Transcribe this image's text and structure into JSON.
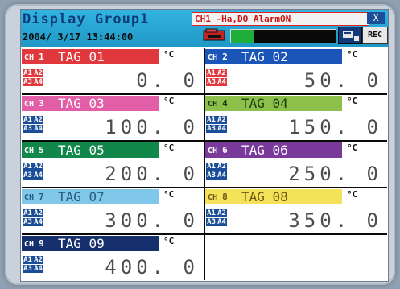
{
  "header": {
    "title": "Display Group1",
    "datetime": "2004/ 3/17 13:44:00",
    "alarm_text": "CH1 -Ha,DO AlarmON",
    "alarm_close": "X",
    "rec_label": "REC",
    "memory_fill_fraction": 0.22,
    "colors": {
      "header_bg": "#2aa9d6",
      "alarm_text": "#d01010",
      "memory_bar": "#1fae3a"
    }
  },
  "channels": [
    {
      "ch": "1",
      "tag": "TAG 01",
      "unit": "°C",
      "value": "0. 0",
      "color": "#e0383d",
      "tag_text": "#ffffff",
      "alarms": [
        "A1",
        "A2",
        "A3",
        "A4"
      ],
      "alarm_color": "#e0383d"
    },
    {
      "ch": "2",
      "tag": "TAG 02",
      "unit": "°C",
      "value": "50. 0",
      "color": "#1c55b8",
      "tag_text": "#ffffff",
      "alarms": [
        "A1",
        "A2",
        "A3",
        "A4"
      ],
      "alarm_color": "#e0383d"
    },
    {
      "ch": "3",
      "tag": "TAG 03",
      "unit": "°C",
      "value": "100. 0",
      "color": "#e25fa8",
      "tag_text": "#ffffff",
      "alarms": [
        "A1",
        "A2",
        "A3",
        "A4"
      ],
      "alarm_color": "#1b4e98"
    },
    {
      "ch": "4",
      "tag": "TAG 04",
      "unit": "°C",
      "value": "150. 0",
      "color": "#8cc04a",
      "tag_text": "#1a3a10",
      "alarms": [
        "A1",
        "A2",
        "A3",
        "A4"
      ],
      "alarm_color": "#1b4e98"
    },
    {
      "ch": "5",
      "tag": "TAG 05",
      "unit": "°C",
      "value": "200. 0",
      "color": "#12874a",
      "tag_text": "#ffffff",
      "alarms": [
        "A1",
        "A2",
        "A3",
        "A4"
      ],
      "alarm_color": "#1b4e98"
    },
    {
      "ch": "6",
      "tag": "TAG 06",
      "unit": "°C",
      "value": "250. 0",
      "color": "#7a3a9c",
      "tag_text": "#ffffff",
      "alarms": [
        "A1",
        "A2",
        "A3",
        "A4"
      ],
      "alarm_color": "#1b4e98"
    },
    {
      "ch": "7",
      "tag": "TAG 07",
      "unit": "°C",
      "value": "300. 0",
      "color": "#7fc8ea",
      "tag_text": "#2a5a80",
      "alarms": [
        "A1",
        "A2",
        "A3",
        "A4"
      ],
      "alarm_color": "#1b4e98"
    },
    {
      "ch": "8",
      "tag": "TAG 08",
      "unit": "°C",
      "value": "350. 0",
      "color": "#f4e25a",
      "tag_text": "#6a5a10",
      "alarms": [
        "A1",
        "A2",
        "A3",
        "A4"
      ],
      "alarm_color": "#1b4e98"
    },
    {
      "ch": "9",
      "tag": "TAG 09",
      "unit": "°C",
      "value": "400. 0",
      "color": "#16306e",
      "tag_text": "#ffffff",
      "alarms": [
        "A1",
        "A2",
        "A3",
        "A4"
      ],
      "alarm_color": "#1b4e98"
    }
  ]
}
